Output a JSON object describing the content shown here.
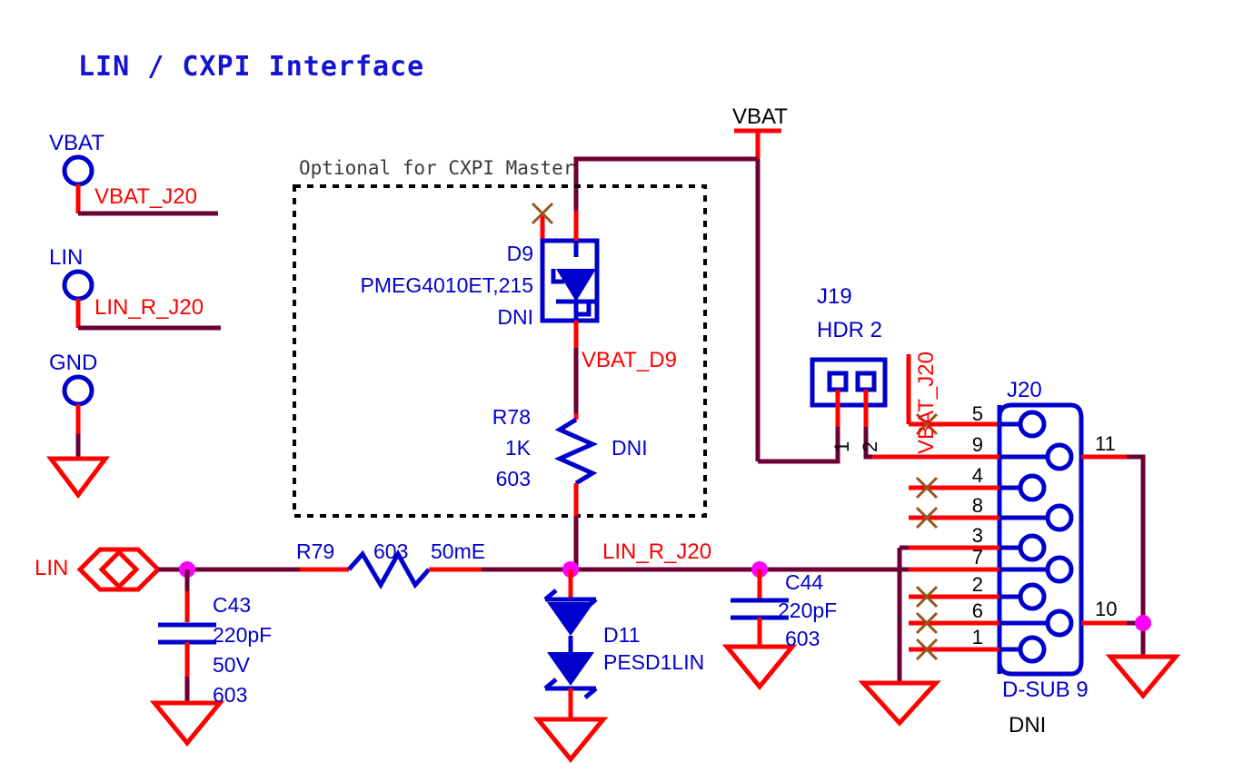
{
  "sheet": {
    "title": "LIN / CXPI Interface",
    "note_optional": "Optional for CXPI Master"
  },
  "colors": {
    "wire": "#6B0036",
    "pin": "#FF0000",
    "symbol": "#0000CC",
    "junction": "#FF00FF",
    "nonet_x": "#96551E",
    "net_label": "#FF0000",
    "title": "#1414D2",
    "designator": "#0000CC",
    "power_bar": "#FF0000",
    "gnd": "#FF0000",
    "dashed_box": "#000000"
  },
  "testpoints": [
    {
      "name": "tp-vbat",
      "label": "VBAT",
      "net": "VBAT_J20"
    },
    {
      "name": "tp-lin",
      "label": "LIN",
      "net": "LIN_R_J20"
    },
    {
      "name": "tp-gnd",
      "label": "GND",
      "net": ""
    }
  ],
  "power_symbols": [
    {
      "name": "vbat-top",
      "label": "VBAT"
    }
  ],
  "ports": [
    {
      "name": "lin-port",
      "label": "LIN",
      "style": "bidirectional"
    }
  ],
  "net_labels": [
    {
      "name": "net-vbat-j20-tp",
      "text": "VBAT_J20"
    },
    {
      "name": "net-lin-r-j20-tp",
      "text": "LIN_R_J20"
    },
    {
      "name": "net-vbat-d9",
      "text": "VBAT_D9"
    },
    {
      "name": "net-lin-r-j20-main",
      "text": "LIN_R_J20"
    },
    {
      "name": "net-vbat-j20-vertical",
      "text": "VBAT_J20"
    }
  ],
  "components": [
    {
      "ref": "D9",
      "name": "diode-d9",
      "value": "PMEG4010ET,215",
      "fit": "DNI",
      "type": "schottky-diode"
    },
    {
      "ref": "R78",
      "name": "resistor-r78",
      "value": "1K",
      "package": "603",
      "fit": "DNI",
      "type": "resistor"
    },
    {
      "ref": "R79",
      "name": "resistor-r79",
      "package": "603",
      "value": "50mE",
      "type": "resistor"
    },
    {
      "ref": "C43",
      "name": "capacitor-c43",
      "value": "220pF",
      "voltage": "50V",
      "package": "603",
      "type": "capacitor"
    },
    {
      "ref": "C44",
      "name": "capacitor-c44",
      "value": "220pF",
      "package": "603",
      "type": "capacitor"
    },
    {
      "ref": "D11",
      "name": "tvs-d11",
      "value": "PESD1LIN",
      "type": "tvs-diode"
    },
    {
      "ref": "J19",
      "name": "header-j19",
      "value": "HDR 2",
      "type": "header",
      "pins": [
        "1",
        "2"
      ]
    },
    {
      "ref": "J20",
      "name": "connector-j20",
      "value": "D-SUB 9",
      "fit": "DNI",
      "type": "d-sub-9",
      "pins_left": [
        "5",
        "9",
        "4",
        "8",
        "3",
        "7",
        "2",
        "6",
        "1"
      ],
      "pins_right": [
        "11",
        "10"
      ]
    }
  ],
  "pin_numbers": {
    "j19": [
      "1",
      "2"
    ],
    "j20_left": [
      "5",
      "9",
      "4",
      "8",
      "3",
      "7",
      "2",
      "6",
      "1"
    ],
    "j20_right_top": "11",
    "j20_right_bottom": "10"
  },
  "chart_data": {
    "type": "diagram",
    "title": "LIN / CXPI Interface schematic"
  }
}
